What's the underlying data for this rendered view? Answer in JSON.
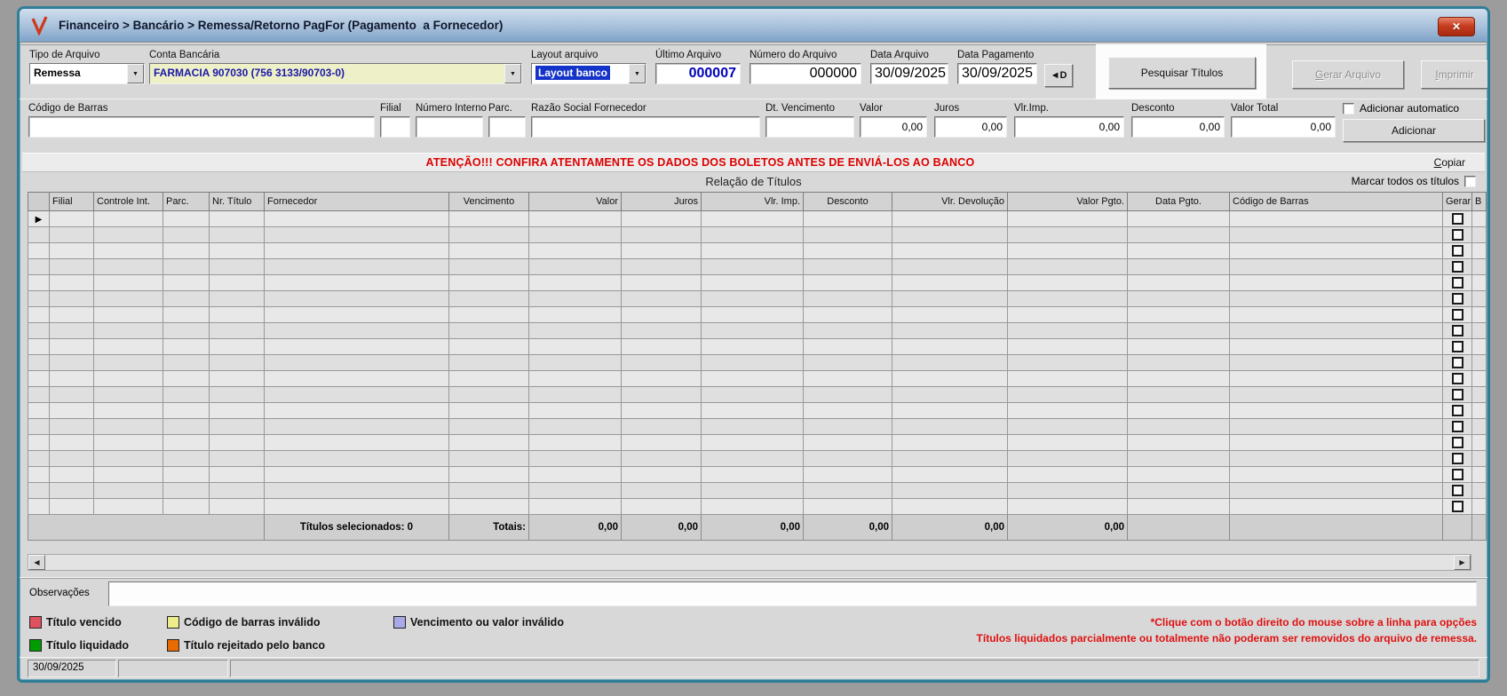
{
  "window": {
    "title": "Financeiro > Bancário > Remessa/Retorno PagFor (Pagamento  a Fornecedor)"
  },
  "icons": {
    "close": "✕",
    "dropdown": "▼",
    "scroll_left": "◀",
    "scroll_right": "▶",
    "row_selector": "▶",
    "copy_date": "◄D"
  },
  "toolbar": {
    "tipo_arquivo": {
      "label": "Tipo de Arquivo",
      "value": "Remessa"
    },
    "conta_bancaria": {
      "label": "Conta Bancária",
      "value": "FARMACIA 907030 (756 3133/90703-0)"
    },
    "layout_arquivo": {
      "label": "Layout arquivo",
      "value": "Layout banco"
    },
    "ultimo_arquivo": {
      "label": "Último Arquivo",
      "value": "000007"
    },
    "numero_arquivo": {
      "label": "Número do Arquivo",
      "value": "000000"
    },
    "data_arquivo": {
      "label": "Data Arquivo",
      "value": "30/09/2025"
    },
    "data_pagamento": {
      "label": "Data Pagamento",
      "value": "30/09/2025"
    },
    "pesquisar_label": "Pesquisar Títulos",
    "gerar_initial": "G",
    "gerar_rest": "erar Arquivo",
    "imprimir_initial": "I",
    "imprimir_rest": "mprimir"
  },
  "entry": {
    "codigo_barras": {
      "label": "Código de Barras",
      "value": ""
    },
    "filial": {
      "label": "Filial",
      "value": ""
    },
    "numero_interno": {
      "label": "Número Interno",
      "value": ""
    },
    "parc": {
      "label": "Parc.",
      "value": ""
    },
    "razao_social": {
      "label": "Razão Social Fornecedor",
      "value": ""
    },
    "dt_vencimento": {
      "label": "Dt. Vencimento",
      "value": ""
    },
    "valor": {
      "label": "Valor",
      "value": "0,00"
    },
    "juros": {
      "label": "Juros",
      "value": "0,00"
    },
    "vlr_imp": {
      "label": "Vlr.Imp.",
      "value": "0,00"
    },
    "desconto": {
      "label": "Desconto",
      "value": "0,00"
    },
    "valor_total": {
      "label": "Valor Total",
      "value": "0,00"
    },
    "adicionar_automatico_label": "Adicionar automatico",
    "adicionar_label": "Adicionar"
  },
  "warning": "ATENÇÃO!!! CONFIRA ATENTAMENTE OS DADOS DOS BOLETOS ANTES DE ENVIÁ-LOS AO BANCO",
  "copiar_initial": "C",
  "copiar_rest": "opiar",
  "table": {
    "title": "Relação de Títulos",
    "marcar_todos_label": "Marcar todos os títulos",
    "row_count": 19,
    "columns": [
      {
        "label": "Filial"
      },
      {
        "label": "Controle Int."
      },
      {
        "label": "Parc."
      },
      {
        "label": "Nr. Título"
      },
      {
        "label": "Fornecedor"
      },
      {
        "label": "Vencimento"
      },
      {
        "label": "Valor"
      },
      {
        "label": "Juros"
      },
      {
        "label": "Vlr. Imp."
      },
      {
        "label": "Desconto"
      },
      {
        "label": "Vlr. Devolução"
      },
      {
        "label": "Valor Pgto."
      },
      {
        "label": "Data Pgto."
      },
      {
        "label": "Código de Barras"
      },
      {
        "label": "Gerar"
      },
      {
        "label": "B"
      }
    ],
    "totals": {
      "selecionados": "Títulos selecionados: 0",
      "label": "Totais:",
      "values": [
        "0,00",
        "0,00",
        "0,00",
        "0,00",
        "0,00",
        "0,00"
      ]
    }
  },
  "observacoes": {
    "label": "Observações",
    "value": ""
  },
  "legend": [
    {
      "label": "Título vencido",
      "color": "#e0515f"
    },
    {
      "label": "Código de barras inválido",
      "color": "#ecec8c"
    },
    {
      "label": "Vencimento ou valor inválido",
      "color": "#a9a9e8"
    },
    {
      "label": "Título liquidado",
      "color": "#009c00"
    },
    {
      "label": "Título rejeitado pelo banco",
      "color": "#e96a00"
    }
  ],
  "notes": [
    "*Clique com o botão direito do mouse sobre a linha para opções",
    "Títulos liquidados parcialmente ou totalmente não poderam ser removidos do arquivo de remessa."
  ],
  "statusbar": {
    "date": "30/09/2025"
  },
  "colors": {
    "window_border": "#2f7e97",
    "titlebar_top": "#cfdeee",
    "titlebar_bottom": "#7fa3c9",
    "close_button_red": "#c63d20",
    "selection_blue": "#1433c8",
    "conta_field_yellow": "#eef0c8",
    "value_navy": "#0000b8",
    "warning_red": "#dd0000",
    "notes_red": "#e01010"
  }
}
